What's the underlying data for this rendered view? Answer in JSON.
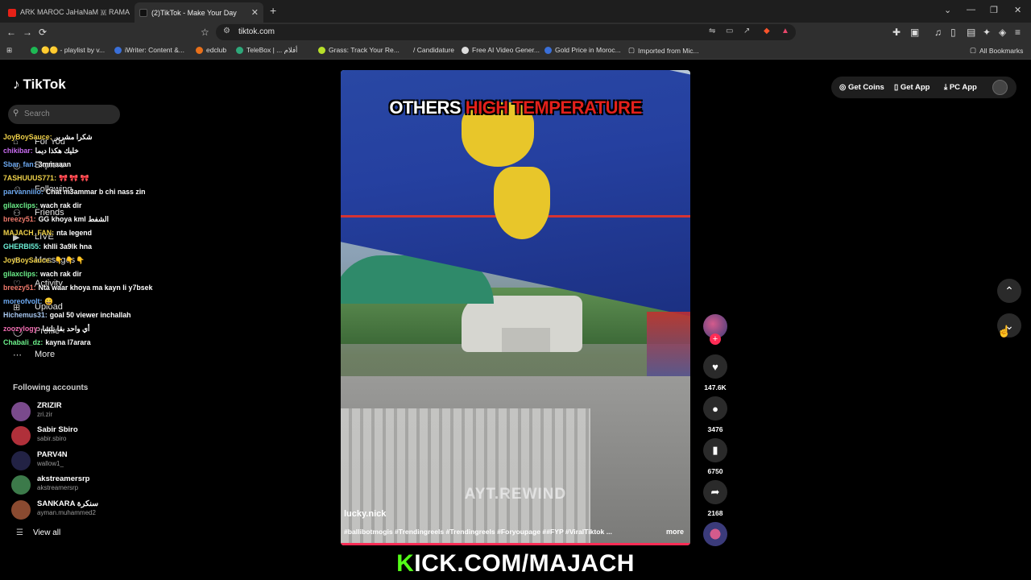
{
  "browser": {
    "tabs": [
      {
        "title": "ARK MAROC JaHaNaM 🇲 RAMA",
        "favicon_color": "#e62117",
        "active": false
      },
      {
        "title": "(2)TikTok - Make Your Day",
        "favicon_color": "#111111",
        "active": true
      }
    ],
    "new_tab": "+",
    "window_controls": [
      "⌄",
      "—",
      "❐",
      "✕"
    ],
    "nav": {
      "back": "←",
      "forward": "→",
      "reload": "⟳",
      "bookmark": "☆"
    },
    "url": "tiktok.com",
    "bookmarks": [
      {
        "label": "🟡🟡 - playlist by v...",
        "color": "#1db954"
      },
      {
        "label": "iWriter: Content &...",
        "color": "#3a6fd8"
      },
      {
        "label": "edclub",
        "color": "#e8701a"
      },
      {
        "label": "TeleBox | ... أفلام",
        "color": "#2ea87a"
      },
      {
        "label": "Grass: Track Your Re...",
        "color": "#b8e02a"
      },
      {
        "label": "/ Candidature",
        "color": "#888888"
      },
      {
        "label": "Free AI Video Gener...",
        "color": "#dddddd"
      },
      {
        "label": "Gold Price in Moroc...",
        "color": "#3a6fd8"
      },
      {
        "label": "Imported from Mic...",
        "color": "#aaaaaa"
      }
    ],
    "all_bookmarks": "All Bookmarks"
  },
  "tiktok": {
    "logo": "TikTok",
    "search_placeholder": "Search",
    "nav": [
      {
        "label": "For You",
        "icon": "home-icon"
      },
      {
        "label": "Explore",
        "icon": "compass-icon"
      },
      {
        "label": "Following",
        "icon": "following-icon"
      },
      {
        "label": "Friends",
        "icon": "friends-icon"
      },
      {
        "label": "LIVE",
        "icon": "live-icon"
      },
      {
        "label": "Messages",
        "icon": "message-icon"
      },
      {
        "label": "Activity",
        "icon": "activity-icon"
      },
      {
        "label": "Upload",
        "icon": "upload-icon"
      },
      {
        "label": "Profile",
        "icon": "profile-icon"
      },
      {
        "label": "More",
        "icon": "more-icon"
      }
    ],
    "following_title": "Following accounts",
    "following": [
      {
        "name": "ZRIZIR",
        "handle": "zri.zir",
        "color": "#7a4a8c"
      },
      {
        "name": "Sabir Sbiro",
        "handle": "sabir.sbiro",
        "color": "#b0303a"
      },
      {
        "name": "PARV4N",
        "handle": "wallow1_",
        "color": "#222244"
      },
      {
        "name": "akstreamersrp",
        "handle": "akstreamersrp",
        "color": "#3c7a4a"
      },
      {
        "name": "SANKARA سنكرة",
        "handle": "ayman.muhammed2",
        "color": "#8a4a30"
      }
    ],
    "view_all": "View all",
    "top_actions": {
      "coins": "Get Coins",
      "app": "Get App",
      "pc": "PC App"
    }
  },
  "chat": [
    {
      "user": "JoyBoySauce:",
      "msg": "شكرا مشرير",
      "color": "#f0d24a"
    },
    {
      "user": "chikibar:",
      "msg": "خليك هكذا ديما",
      "color": "#c86cf0"
    },
    {
      "user": "Sbar_fan:",
      "msg": "3mmaaan",
      "color": "#6ca8f0"
    },
    {
      "user": "7ASHUUUS771:",
      "msg": "🎀 🎀 🎀",
      "color": "#f0d24a"
    },
    {
      "user": "parvanniiio:",
      "msg": "Chat m3ammar b chi nass zin",
      "color": "#6ca8f0"
    },
    {
      "user": "gilaxclips:",
      "msg": "wach rak dir",
      "color": "#6cf08a"
    },
    {
      "user": "breezy51:",
      "msg": "GG khoya kml الشفط",
      "color": "#f07a6c"
    },
    {
      "user": "MAJACH_FAN:",
      "msg": "nta legend",
      "color": "#f0d24a"
    },
    {
      "user": "GHERBI55:",
      "msg": "khlli 3a9lk hna",
      "color": "#6cf0d8"
    },
    {
      "user": "JoyBoySauce:",
      "msg": "👇 👇 👇",
      "color": "#f0d24a"
    },
    {
      "user": "gilaxclips:",
      "msg": "wach rak dir",
      "color": "#6cf08a"
    },
    {
      "user": "breezy51:",
      "msg": "Nta waar khoya ma kayn li y7bsek",
      "color": "#f07a6c"
    },
    {
      "user": "moreofvolt:",
      "msg": "😀",
      "color": "#6ca8f0"
    },
    {
      "user": "Hichemus31:",
      "msg": "goal 50 viewer inchallah",
      "color": "#a8c8f0"
    },
    {
      "user": "zoozylogy:",
      "msg": "أي واحد بقا يلشا",
      "color": "#f06cb0"
    },
    {
      "user": "Chabali_dz:",
      "msg": "kayna l7arara",
      "color": "#6cf08a"
    }
  ],
  "video": {
    "caption_white": "OTHERS",
    "caption_red": "HIGH TEMPERATURE",
    "watermark": "AYT.REWIND",
    "author": "lucky.nick",
    "description": "#ballibotmogis #Trendingreels #Trendingreels #Foryoupage ##FYP #ViralTiktok ...",
    "more": "more",
    "progress": 1.0
  },
  "actions": {
    "likes": "147.6K",
    "comments": "3476",
    "saves": "6750",
    "shares": "2168"
  },
  "overlay": {
    "kick_k": "K",
    "kick_rest": "ICK.COM/MAJACH"
  },
  "colors": {
    "accent": "#fe2c55",
    "kick_green": "#53fc18"
  }
}
